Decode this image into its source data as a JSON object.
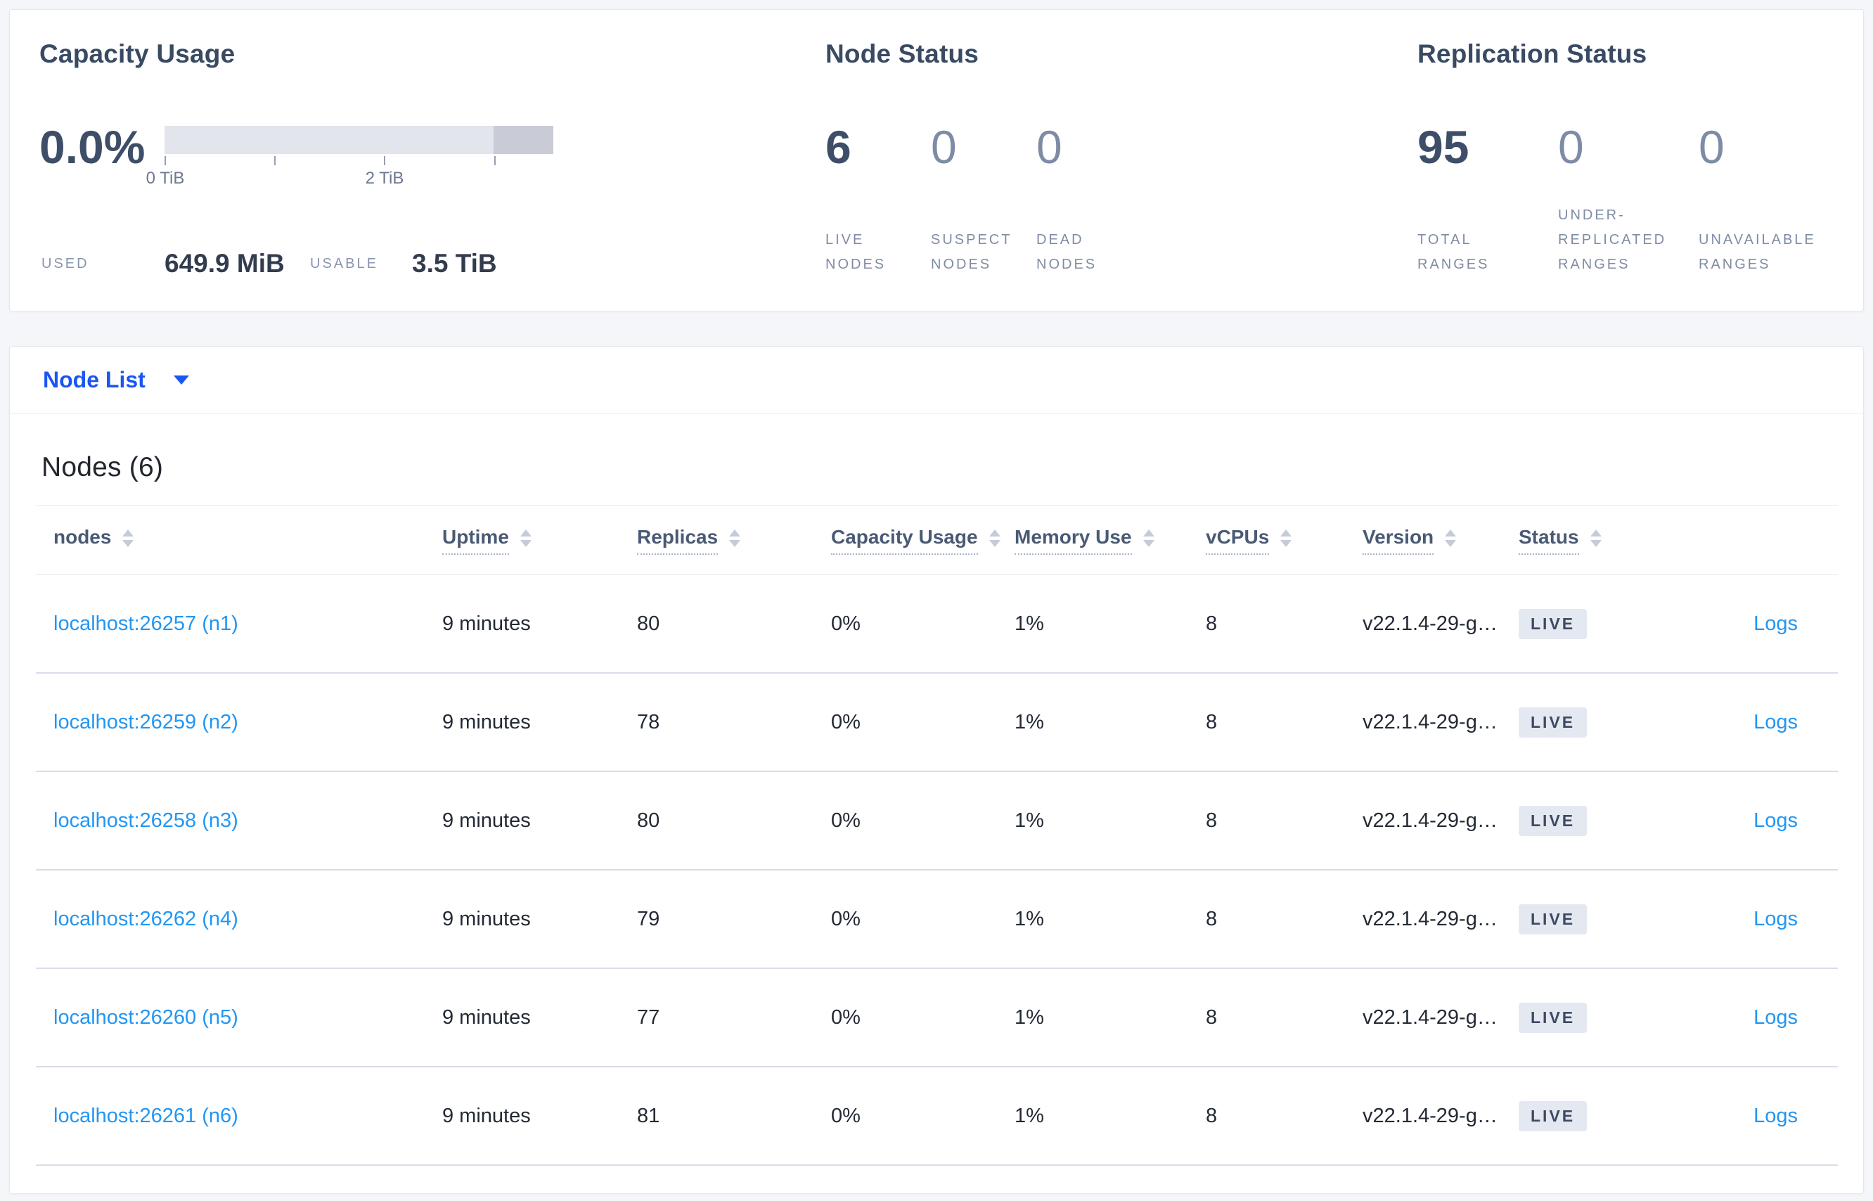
{
  "capacity": {
    "title": "Capacity Usage",
    "percent": "0.0%",
    "tick_labels": [
      "0 TiB",
      "2 TiB"
    ],
    "used_label": "USED",
    "used_value": "649.9 MiB",
    "usable_label": "USABLE",
    "usable_value": "3.5 TiB"
  },
  "node_status": {
    "title": "Node Status",
    "stats": [
      {
        "value": "6",
        "label": "LIVE NODES",
        "emphasis": "dark"
      },
      {
        "value": "0",
        "label": "SUSPECT NODES",
        "emphasis": "light"
      },
      {
        "value": "0",
        "label": "DEAD NODES",
        "emphasis": "light"
      }
    ]
  },
  "replication": {
    "title": "Replication Status",
    "stats": [
      {
        "value": "95",
        "label": "TOTAL RANGES",
        "emphasis": "dark"
      },
      {
        "value": "0",
        "label": "UNDER-REPLICATED RANGES",
        "emphasis": "light"
      },
      {
        "value": "0",
        "label": "UNAVAILABLE RANGES",
        "emphasis": "light"
      }
    ]
  },
  "node_list": {
    "label": "Node List"
  },
  "nodes_panel": {
    "title": "Nodes (6)",
    "columns": {
      "nodes": "nodes",
      "uptime": "Uptime",
      "replicas": "Replicas",
      "capacity": "Capacity Usage",
      "memory": "Memory Use",
      "vcpus": "vCPUs",
      "version": "Version",
      "status": "Status"
    },
    "rows": [
      {
        "node": "localhost:26257 (n1)",
        "uptime": "9 minutes",
        "replicas": "80",
        "capacity": "0%",
        "memory": "1%",
        "vcpus": "8",
        "version": "v22.1.4-29-g…",
        "status": "LIVE",
        "logs": "Logs"
      },
      {
        "node": "localhost:26259 (n2)",
        "uptime": "9 minutes",
        "replicas": "78",
        "capacity": "0%",
        "memory": "1%",
        "vcpus": "8",
        "version": "v22.1.4-29-g…",
        "status": "LIVE",
        "logs": "Logs"
      },
      {
        "node": "localhost:26258 (n3)",
        "uptime": "9 minutes",
        "replicas": "80",
        "capacity": "0%",
        "memory": "1%",
        "vcpus": "8",
        "version": "v22.1.4-29-g…",
        "status": "LIVE",
        "logs": "Logs"
      },
      {
        "node": "localhost:26262 (n4)",
        "uptime": "9 minutes",
        "replicas": "79",
        "capacity": "0%",
        "memory": "1%",
        "vcpus": "8",
        "version": "v22.1.4-29-g…",
        "status": "LIVE",
        "logs": "Logs"
      },
      {
        "node": "localhost:26260 (n5)",
        "uptime": "9 minutes",
        "replicas": "77",
        "capacity": "0%",
        "memory": "1%",
        "vcpus": "8",
        "version": "v22.1.4-29-g…",
        "status": "LIVE",
        "logs": "Logs"
      },
      {
        "node": "localhost:26261 (n6)",
        "uptime": "9 minutes",
        "replicas": "81",
        "capacity": "0%",
        "memory": "1%",
        "vcpus": "8",
        "version": "v22.1.4-29-g…",
        "status": "LIVE",
        "logs": "Logs"
      }
    ]
  },
  "colors": {
    "page_bg": "#f4f6fa",
    "accent_blue": "#1a56f0",
    "link_blue": "#2196f3",
    "dark_stat": "#3e4e68",
    "light_stat": "#7e8ba6",
    "bar_light": "#e3e5ec",
    "bar_dark": "#c9ccd7",
    "badge_bg": "#e4e9f1",
    "badge_text": "#3e4a63"
  }
}
